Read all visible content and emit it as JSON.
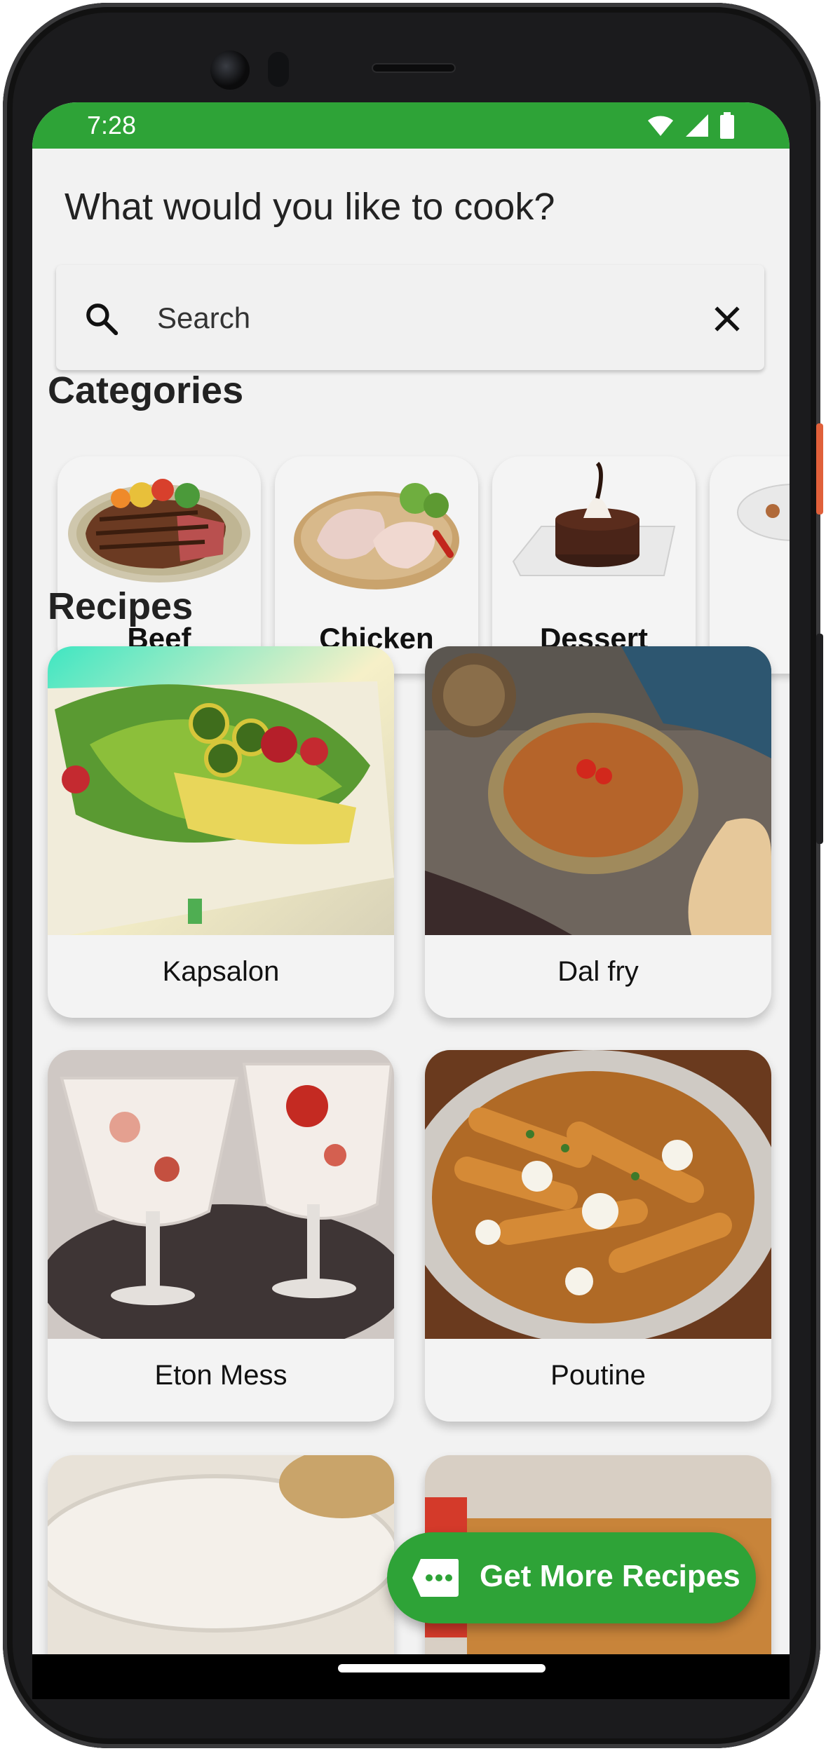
{
  "status_bar": {
    "time": "7:28"
  },
  "header": {
    "question": "What would you like to cook?"
  },
  "search": {
    "placeholder": "Search"
  },
  "categories": {
    "heading": "Categories",
    "items": [
      {
        "label": "Beef"
      },
      {
        "label": "Chicken"
      },
      {
        "label": "Dessert"
      }
    ]
  },
  "recipes": {
    "heading": "Recipes",
    "items": [
      {
        "title": "Kapsalon"
      },
      {
        "title": "Dal fry"
      },
      {
        "title": "Eton Mess"
      },
      {
        "title": "Poutine"
      }
    ]
  },
  "fab": {
    "label": "Get More Recipes",
    "icon": "chat-bubble-icon"
  },
  "colors": {
    "accent": "#2ea337",
    "background": "#f2f2f2"
  }
}
